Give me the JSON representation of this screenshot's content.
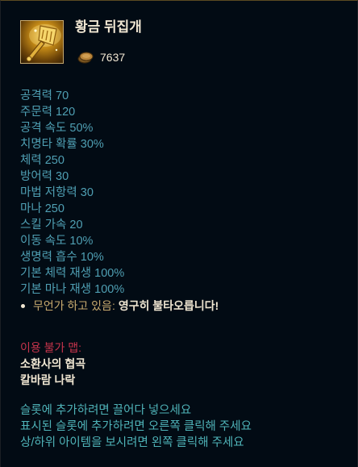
{
  "item": {
    "name": "황금 뒤집개",
    "icon": "golden-spatula-icon",
    "price": "7637",
    "currency_icon": "gold-coin-icon"
  },
  "stats": [
    "공격력 70",
    "주문력 120",
    "공격 속도 50%",
    "치명타 확률 30%",
    "체력 250",
    "방어력 30",
    "마법 저항력 30",
    "마나 250",
    "스킬 가속 20",
    "이동 속도 10%",
    "생명력 흡수 10%",
    "기본 체력 재생 100%",
    "기본 마나 재생 100%"
  ],
  "passive": {
    "label": "무언가 하고 있음:",
    "text": "영구히 불타오릅니다!"
  },
  "unavailable": {
    "header": "이용 불가 맵:",
    "maps": [
      "소환사의 협곡",
      "칼바람 나락"
    ]
  },
  "hints": [
    "슬롯에 추가하려면 끌어다 넣으세요",
    "표시된 슬롯에 추가하려면 오른쪽 클릭해 주세요",
    "상/하위 아이템을 보시려면 왼쪽 클릭해 주세요"
  ],
  "colors": {
    "background": "#020b14",
    "stat_text": "#4f9fb3",
    "gold_border": "#c8aa6e",
    "unavailable_red": "#c8344c",
    "hint_text": "#4fb3b8",
    "title_text": "#f0e6d2"
  }
}
